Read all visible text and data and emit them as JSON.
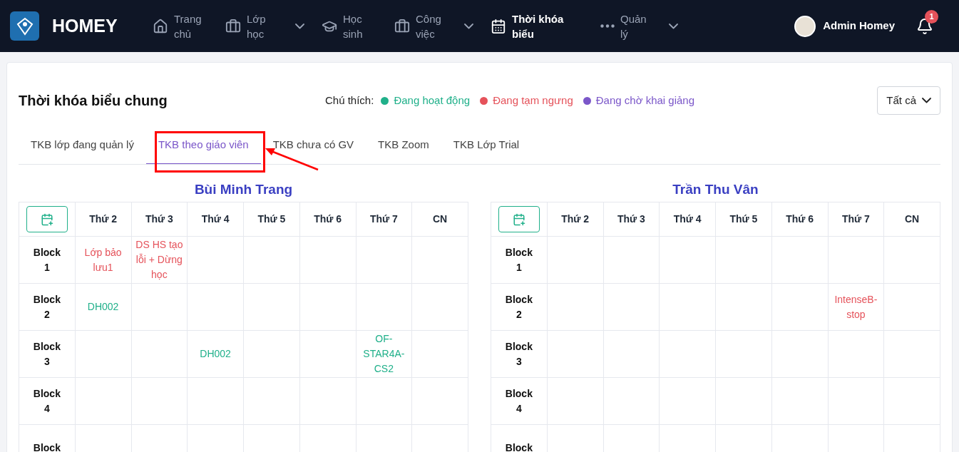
{
  "brand": {
    "name": "HOMEY"
  },
  "nav": [
    {
      "kind": "home",
      "label": "Trang chủ",
      "selected": false,
      "dropdown": false
    },
    {
      "kind": "briefcase",
      "label": "Lớp học",
      "selected": false,
      "dropdown": true
    },
    {
      "kind": "cap",
      "label": "Học sinh",
      "selected": false,
      "dropdown": false
    },
    {
      "kind": "briefcase",
      "label": "Công việc",
      "selected": false,
      "dropdown": true
    },
    {
      "kind": "calendar",
      "label": "Thời khóa biểu",
      "selected": true,
      "dropdown": false
    },
    {
      "kind": "dots",
      "label": "Quản lý",
      "selected": false,
      "dropdown": true
    }
  ],
  "user": {
    "name": "Admin Homey"
  },
  "notifications": {
    "count": "1"
  },
  "page": {
    "title": "Thời khóa biểu chung"
  },
  "legend": {
    "label": "Chú thích:",
    "items": [
      {
        "label": "Đang hoạt động",
        "color": "#20b08a"
      },
      {
        "label": "Đang tạm ngưng",
        "color": "#e5525a"
      },
      {
        "label": "Đang chờ khai giảng",
        "color": "#7b57c9"
      }
    ]
  },
  "filter": {
    "value": "Tất cả"
  },
  "tabs": [
    {
      "label": "TKB lớp đang quản lý",
      "selected": false
    },
    {
      "label": "TKB theo giáo viên",
      "selected": true
    },
    {
      "label": "TKB chưa có GV",
      "selected": false
    },
    {
      "label": "TKB Zoom",
      "selected": false
    },
    {
      "label": "TKB Lớp Trial",
      "selected": false
    }
  ],
  "timetables": [
    {
      "teacher": "Bùi Minh Trang",
      "days": [
        "Thứ 2",
        "Thứ 3",
        "Thứ 4",
        "Thứ 5",
        "Thứ 6",
        "Thứ 7",
        "CN"
      ],
      "rows": [
        {
          "label": "Block 1",
          "cells": [
            {
              "text": "Lớp bảo lưu1",
              "color": "#e5525a"
            },
            {
              "text": "DS HS tạo lỗi + Dừng học",
              "color": "#e5525a"
            },
            null,
            null,
            null,
            null,
            null
          ]
        },
        {
          "label": "Block 2",
          "cells": [
            {
              "text": "DH002",
              "color": "#20b08a"
            },
            null,
            null,
            null,
            null,
            null,
            null
          ]
        },
        {
          "label": "Block 3",
          "cells": [
            null,
            null,
            {
              "text": "DH002",
              "color": "#20b08a"
            },
            null,
            null,
            {
              "text": "OF-STAR4A-CS2",
              "color": "#20b08a"
            },
            null
          ]
        },
        {
          "label": "Block 4",
          "cells": [
            null,
            null,
            null,
            null,
            null,
            null,
            null
          ]
        },
        {
          "label": "Block",
          "cells": [
            null,
            null,
            null,
            null,
            null,
            null,
            null
          ]
        }
      ]
    },
    {
      "teacher": "Trần Thu Vân",
      "days": [
        "Thứ 2",
        "Thứ 3",
        "Thứ 4",
        "Thứ 5",
        "Thứ 6",
        "Thứ 7",
        "CN"
      ],
      "rows": [
        {
          "label": "Block 1",
          "cells": [
            null,
            null,
            null,
            null,
            null,
            null,
            null
          ]
        },
        {
          "label": "Block 2",
          "cells": [
            null,
            null,
            null,
            null,
            null,
            {
              "text": "IntenseB-stop",
              "color": "#e5525a"
            },
            null
          ]
        },
        {
          "label": "Block 3",
          "cells": [
            null,
            null,
            null,
            null,
            null,
            null,
            null
          ]
        },
        {
          "label": "Block 4",
          "cells": [
            null,
            null,
            null,
            null,
            null,
            null,
            null
          ]
        },
        {
          "label": "Block",
          "cells": [
            null,
            null,
            null,
            null,
            null,
            null,
            null
          ]
        }
      ]
    }
  ]
}
